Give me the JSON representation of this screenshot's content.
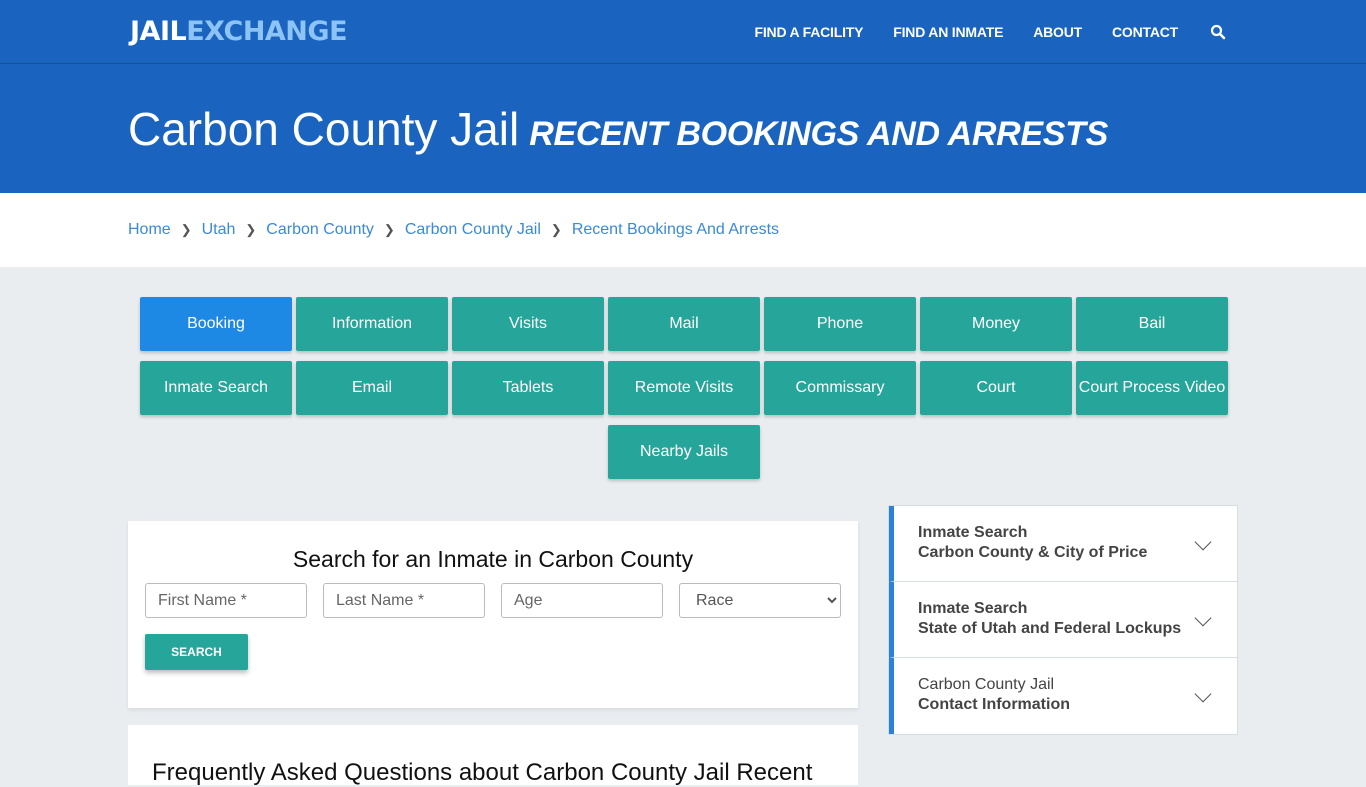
{
  "header": {
    "logo_part1": "JAIL",
    "logo_part2": "EXCHANGE",
    "nav": [
      "FIND A FACILITY",
      "FIND AN INMATE",
      "ABOUT",
      "CONTACT"
    ],
    "search_icon": "search-icon"
  },
  "hero": {
    "title": "Carbon County Jail",
    "subtitle": "RECENT BOOKINGS AND ARRESTS"
  },
  "breadcrumb": [
    "Home",
    "Utah",
    "Carbon County",
    "Carbon County Jail",
    "Recent Bookings And Arrests"
  ],
  "buttons": {
    "row1": [
      "Booking",
      "Information",
      "Visits",
      "Mail",
      "Phone",
      "Money",
      "Bail"
    ],
    "row2": [
      "Inmate Search",
      "Email",
      "Tablets",
      "Remote Visits",
      "Commissary",
      "Court",
      "Court Process Video"
    ],
    "row3": [
      "Nearby Jails"
    ],
    "active": "Booking"
  },
  "search": {
    "title": "Search for an Inmate in Carbon County",
    "first_name_placeholder": "First Name *",
    "last_name_placeholder": "Last Name *",
    "age_placeholder": "Age",
    "race_selected": "Race",
    "button": "SEARCH"
  },
  "faq": {
    "title": "Frequently Asked Questions about Carbon County Jail Recent"
  },
  "sidebar": [
    {
      "line1": "Inmate Search",
      "line2": "Carbon County & City of Price"
    },
    {
      "line1": "Inmate Search",
      "line2": "State of Utah and Federal Lockups"
    },
    {
      "line1": "Carbon County Jail",
      "line2": "Contact Information"
    }
  ]
}
